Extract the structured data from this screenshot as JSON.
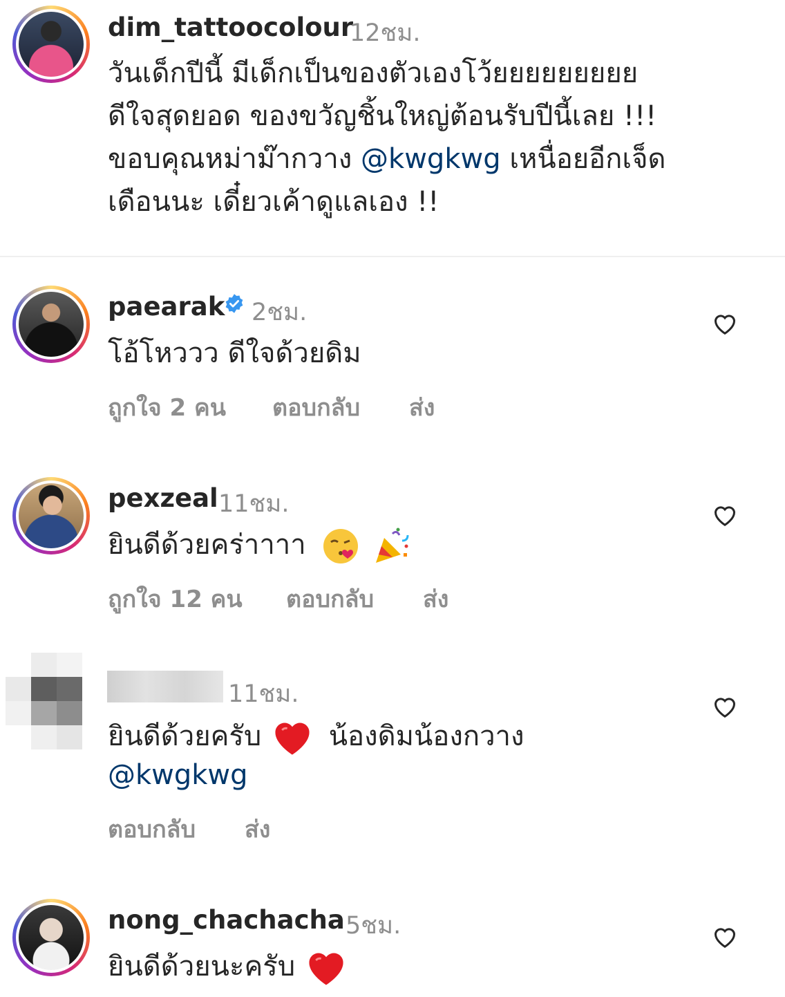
{
  "caption": {
    "username": "dim_tattoocolour",
    "time": "12ชม.",
    "lines": [
      "วันเด็กปีนี้ มีเด็กเป็นของตัวเองโว้ยยยยยยยยย",
      "ดีใจสุดยอด ของขวัญชิ้นใหญ่ต้อนรับปีนี้เลย !!!",
      "ขอบคุณหม่าม๊ากวาง",
      "เหนื่อยอีกเจ็ด",
      "เดือนนะ เดี๋ยวเค้าดูแลเอง !!"
    ],
    "mention": "@kwgkwg"
  },
  "comments": [
    {
      "username": "paearak",
      "time": "2ชม.",
      "text": "โอ้โหววว ดีใจด้วยดิม",
      "likes": "ถูกใจ 2 คน",
      "reply": "ตอบกลับ",
      "send": "ส่ง"
    },
    {
      "username": "pexzeal",
      "time": "11ชม.",
      "text": "ยินดีด้วยคร่าาาา",
      "likes": "ถูกใจ 12 คน",
      "reply": "ตอบกลับ",
      "send": "ส่ง"
    },
    {
      "username": "",
      "time": "11ชม.",
      "text": "ยินดีด้วยครับ",
      "text_after": "น้องดิมน้องกวาง",
      "mention": "@kwgkwg",
      "reply": "ตอบกลับ",
      "send": "ส่ง"
    },
    {
      "username": "nong_chachacha",
      "time": "5ชม.",
      "text": "ยินดีด้วยนะครับ"
    }
  ]
}
